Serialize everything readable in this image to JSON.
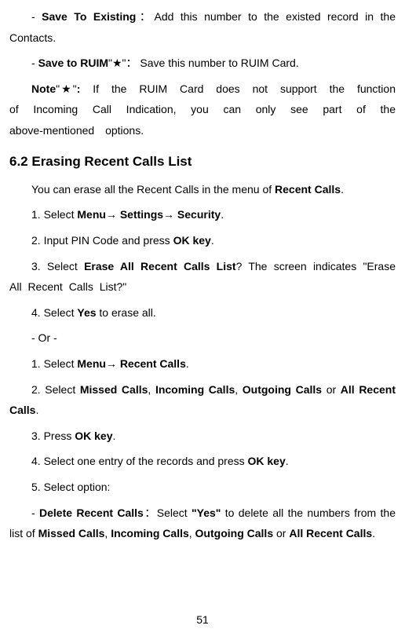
{
  "p1_pre": "- ",
  "p1_bold": "Save To Existing",
  "p1_post": "：Add this number to the existed record in the Contacts.",
  "p2_pre": "- ",
  "p2_bold": "Save to RUIM",
  "p2_post": "\"★\"：  Save this number to RUIM Card.",
  "p3_bold": "Note",
  "p3_mid": "\"★\"",
  "p3_bold2": ":",
  "p3_post": " If the RUIM Card does not support the function of Incoming Call Indication, you can only see part of the above-mentioned options.",
  "h1": "6.2 Erasing Recent Calls List",
  "p4_pre": "You can erase all the Recent Calls in the menu of ",
  "p4_bold": "Recent Calls",
  "p4_post": ".",
  "p5_pre": "1. Select ",
  "p5_bold": "Menu→ Settings→ Security",
  "p5_post": ".",
  "p6_pre": "2. Input PIN Code and press ",
  "p6_bold": "OK key",
  "p6_post": ".",
  "p7_pre": "3. Select ",
  "p7_bold": "Erase All Recent Calls List",
  "p7_post": "? The screen indicates \"Erase All Recent Calls List?\"",
  "p8_pre": "4. Select ",
  "p8_bold": "Yes",
  "p8_post": " to erase all.",
  "p9": "- Or -",
  "p10_pre": "1. Select ",
  "p10_bold": "Menu→ Recent Calls",
  "p10_post": ".",
  "p11_pre": "2. Select ",
  "p11_b1": "Missed Calls",
  "p11_s1": ", ",
  "p11_b2": "Incoming Calls",
  "p11_s2": ", ",
  "p11_b3": "Outgoing Calls",
  "p11_s3": " or ",
  "p11_b4": "All Recent Calls",
  "p11_post": ".",
  "p12_pre": "3. Press ",
  "p12_bold": "OK key",
  "p12_post": ".",
  "p13_pre": "4. Select one entry of the records and press ",
  "p13_bold": "OK key",
  "p13_post": ".",
  "p14": "5. Select option:",
  "p15_pre": "- ",
  "p15_bold": "Delete Recent Calls",
  "p15_mid": "：Select   ",
  "p15_bold2": "\"Yes\"",
  "p15_post": " to delete all the numbers from the list of ",
  "p15_b1": "Missed Calls",
  "p15_s1": ", ",
  "p15_b2": "Incoming Calls",
  "p15_s2": ", ",
  "p15_b3": "Outgoing Calls",
  "p15_s3": " or ",
  "p15_b4": "All Recent Calls",
  "p15_end": ".",
  "pagenum": "51"
}
